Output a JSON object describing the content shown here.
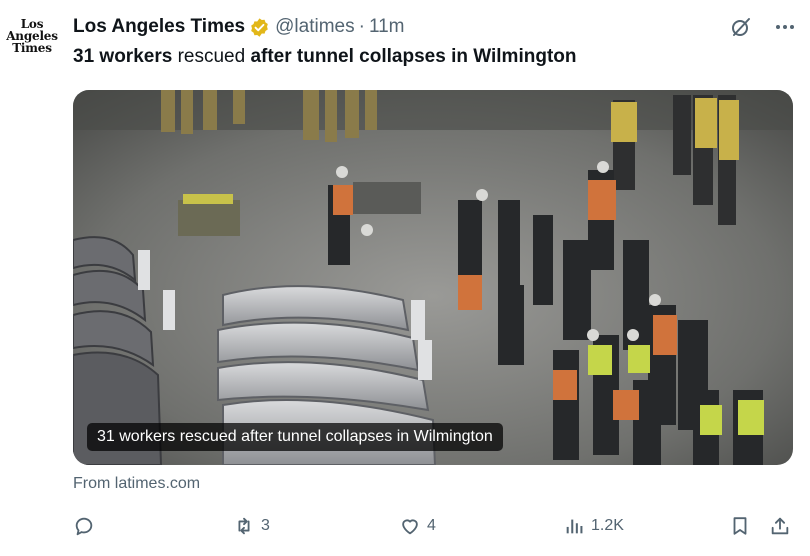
{
  "account": {
    "logo_lines": [
      "Los",
      "Angeles",
      "Times"
    ],
    "name": "Los Angeles Times",
    "handle": "@latimes",
    "separator": "·",
    "time": "11m"
  },
  "tweet": {
    "text_bold_1": "31 workers",
    "text_normal": " rescued ",
    "text_bold_2": "after tunnel collapses in Wilmington"
  },
  "card": {
    "caption": "31 workers rescued after tunnel collapses in Wilmington",
    "source": "From latimes.com"
  },
  "actions": {
    "replies": "",
    "reposts": "3",
    "likes": "4",
    "views": "1.2K"
  },
  "colors": {
    "text": "#0f1419",
    "secondary": "#536471",
    "verified_gold": "#e2b719"
  },
  "icons": [
    "verified-badge-icon",
    "grok-icon",
    "more-icon",
    "reply-icon",
    "repost-icon",
    "like-icon",
    "views-icon",
    "bookmark-icon",
    "share-icon"
  ]
}
